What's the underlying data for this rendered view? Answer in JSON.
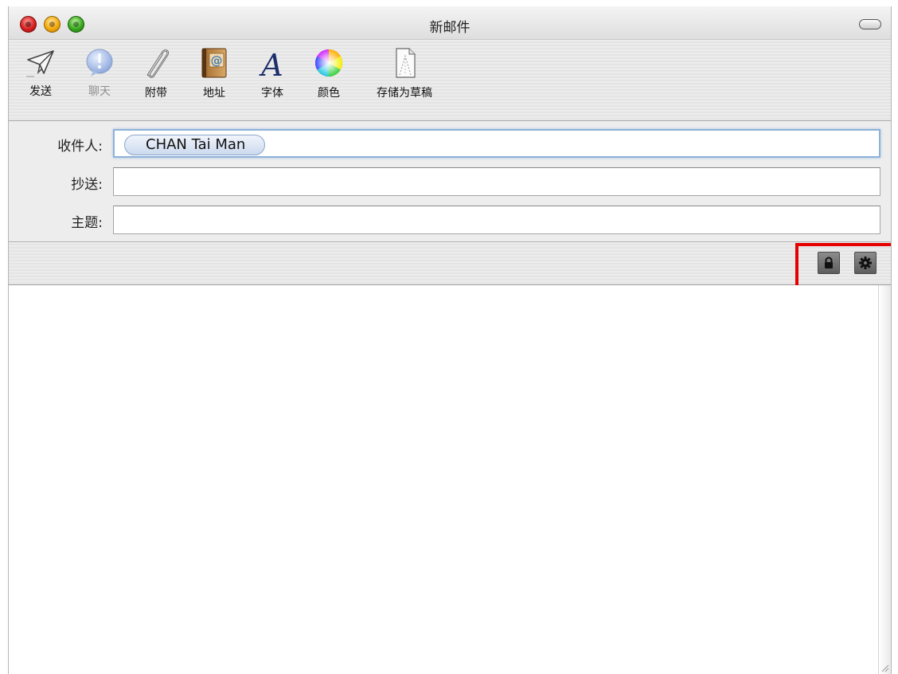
{
  "window": {
    "title": "新邮件"
  },
  "toolbar": {
    "items": [
      {
        "label": "发送",
        "icon": "send-paper-plane-icon",
        "enabled": true
      },
      {
        "label": "聊天",
        "icon": "chat-bubble-icon",
        "enabled": false
      },
      {
        "label": "附带",
        "icon": "paperclip-icon",
        "enabled": true
      },
      {
        "label": "地址",
        "icon": "address-book-icon",
        "enabled": true
      },
      {
        "label": "字体",
        "icon": "font-icon",
        "enabled": true
      },
      {
        "label": "颜色",
        "icon": "color-wheel-icon",
        "enabled": true
      },
      {
        "label": "存储为草稿",
        "icon": "draft-page-icon",
        "enabled": true
      }
    ]
  },
  "fields": {
    "to_label": "收件人:",
    "to_token": "CHAN Tai Man",
    "cc_label": "抄送:",
    "cc_value": "",
    "subject_label": "主题:",
    "subject_value": ""
  },
  "accessory": {
    "lock_icon": "lock-icon",
    "settings_icon": "gear-icon",
    "highlight_color": "#e60000"
  },
  "body": {
    "text": ""
  }
}
